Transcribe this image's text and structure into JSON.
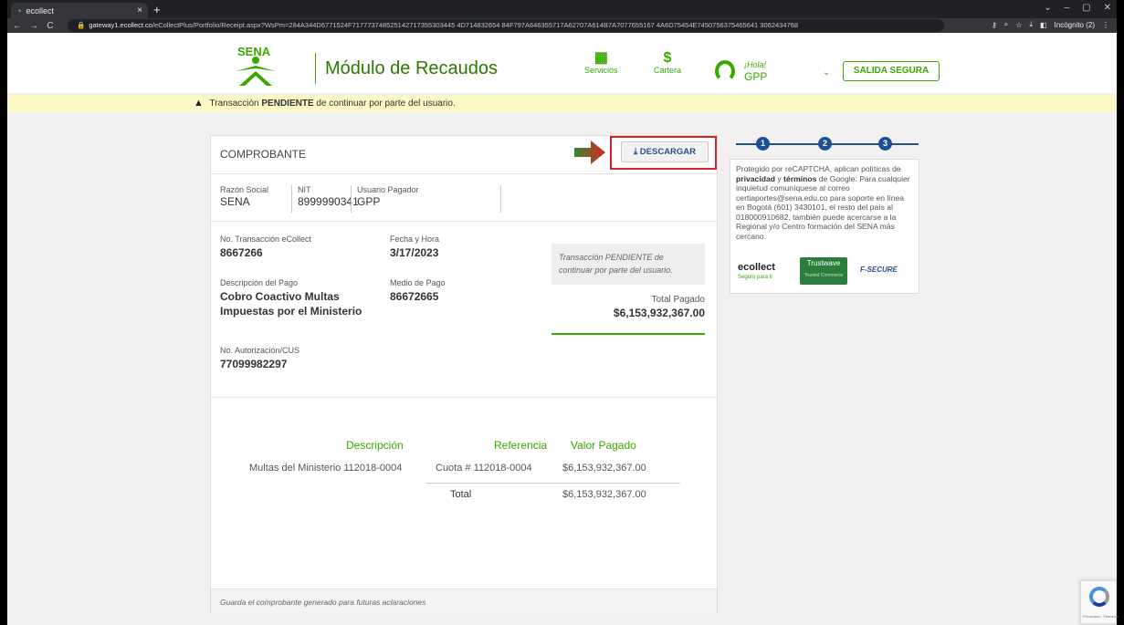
{
  "browser": {
    "tab_title": "ecollect",
    "tab_close": "×",
    "new_tab": "+",
    "url_host": "gateway1.ecollect.co",
    "url_path": "/eCollectPlus/Portfolio/Receipt.aspx?WsPm=284A344D6771524F717773748525142717355303445 4D714832654 84F797A646355717A62707A614B7A7077655167 4A6D75454E7450756375465641 3062434768",
    "incognito_label": "Incógnito (2)",
    "window_controls": [
      "⌄",
      "–",
      "▢",
      "✕"
    ]
  },
  "header": {
    "module_title": "Módulo de Recaudos",
    "nav": [
      {
        "label": "Servicios",
        "icon": "grid-icon"
      },
      {
        "label": "Cartera",
        "icon": "dollar-icon"
      }
    ],
    "greeting": "¡Hola!",
    "user_name": "GPP",
    "logout_label": "SALIDA SEGURA"
  },
  "alert": {
    "prefix": "Transacción",
    "status": "PENDIENTE",
    "suffix": "de continuar por parte del usuario."
  },
  "receipt": {
    "title": "COMPROBANTE",
    "download_label": "DESCARGAR",
    "parties": [
      {
        "label": "Razón Social",
        "value": "SENA"
      },
      {
        "label": "NIT",
        "value": "8999990341"
      },
      {
        "label": "Usuario Pagador",
        "value": "GPP"
      }
    ],
    "transaction_no_label": "No. Transacción eCollect",
    "transaction_no": "8667266",
    "datetime_label": "Fecha y Hora",
    "datetime": "3/17/2023",
    "description_label": "Descripción del Pago",
    "description": "Cobro Coactivo Multas Impuestas por el Ministerio",
    "payment_method_label": "Medio de Pago",
    "payment_method": "86672665",
    "authorization_label": "No. Autorización/CUS",
    "authorization": "77099982297",
    "pending_note": "Transacción PENDIENTE de continuar por parte del usuario.",
    "total_paid_label": "Total Pagado",
    "total_paid": "$6,153,932,367.00",
    "table": {
      "headers": [
        "Descripción",
        "Referencia",
        "Valor Pagado"
      ],
      "row": {
        "description": "Multas del Ministerio 112018-0004",
        "reference": "Cuota # 112018-0004",
        "amount": "$6,153,932,367.00"
      },
      "total_label": "Total",
      "total_amount": "$6,153,932,367.00"
    },
    "footer_note": "Guarda el comprobante generado para futuras aclaraciones"
  },
  "steps": [
    "1",
    "2",
    "3"
  ],
  "info": {
    "text_1": "Protegido por reCAPTCHA, aplican políticas de",
    "privacy": "privacidad",
    "text_2": "y",
    "terms": "términos",
    "text_3": "de Google. Para cualquier inquietud comuníquese al correo certiaportes@sena.edu.co para soporte en línea en Bogotá (601) 3430101, el resto del país al 018000910682, también puede acercarse a la Regional y/o Centro formación del SENA más cercano.",
    "badge_ecollect": "ecollect",
    "badge_ecollect_sub": "Seguro para ti",
    "badge_trust": "Trustwave",
    "badge_trust_sub": "Trusted Commerce",
    "badge_secure": "F-SECURE"
  },
  "recaptcha": {
    "text": "Privacidad - Términos"
  },
  "colors": {
    "brand_green": "#39a900",
    "accent_blue": "#2b4f8a",
    "alert_bg": "#fcf8c5",
    "highlight_red": "#d9232b"
  }
}
